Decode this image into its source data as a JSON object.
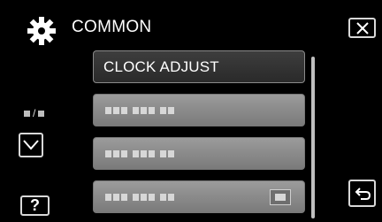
{
  "header": {
    "title": "COMMON",
    "icon": "gear-icon"
  },
  "menu": {
    "items": [
      {
        "label": "CLOCK ADJUST",
        "selected": true
      },
      {
        "label": "",
        "selected": false
      },
      {
        "label": "",
        "selected": false
      },
      {
        "label": "",
        "selected": false
      }
    ]
  },
  "side": {
    "page_indicator": "/",
    "help_label": "?"
  },
  "colors": {
    "background": "#000000",
    "selected_item": "#333333",
    "item": "#8a8a8a",
    "text": "#ffffff"
  }
}
